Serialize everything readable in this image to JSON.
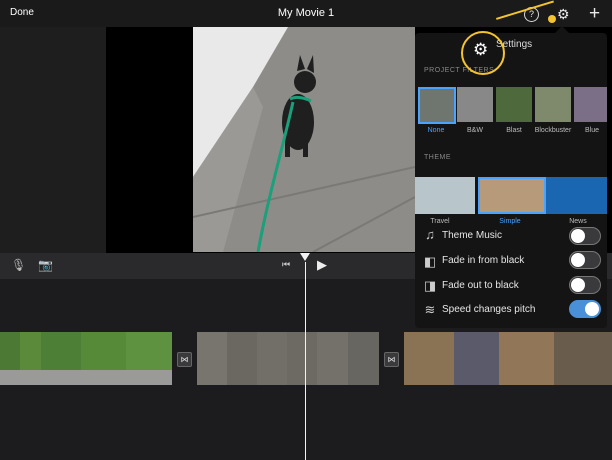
{
  "header": {
    "done_label": "Done",
    "title": "My Movie 1",
    "help_label": "?"
  },
  "settings": {
    "title": "Settings",
    "project_filters_heading": "PROJECT FILTERS",
    "filters": [
      {
        "label": "None",
        "selected": true
      },
      {
        "label": "B&W",
        "selected": false
      },
      {
        "label": "Blast",
        "selected": false
      },
      {
        "label": "Blockbuster",
        "selected": false
      },
      {
        "label": "Blue",
        "selected": false
      }
    ],
    "theme_heading": "THEME",
    "themes": [
      {
        "label": "Travel",
        "selected": false
      },
      {
        "label": "Simple",
        "selected": true
      },
      {
        "label": "News",
        "selected": false
      }
    ],
    "toggles": [
      {
        "label": "Theme Music",
        "icon": "music-note-icon",
        "on": false
      },
      {
        "label": "Fade in from black",
        "icon": "fade-in-icon",
        "on": false
      },
      {
        "label": "Fade out to black",
        "icon": "fade-out-icon",
        "on": false
      },
      {
        "label": "Speed changes pitch",
        "icon": "waveform-icon",
        "on": true
      }
    ]
  },
  "colors": {
    "accent": "#4aa3ff",
    "highlight": "#f4c430",
    "toggle_on": "#4a90d9"
  }
}
